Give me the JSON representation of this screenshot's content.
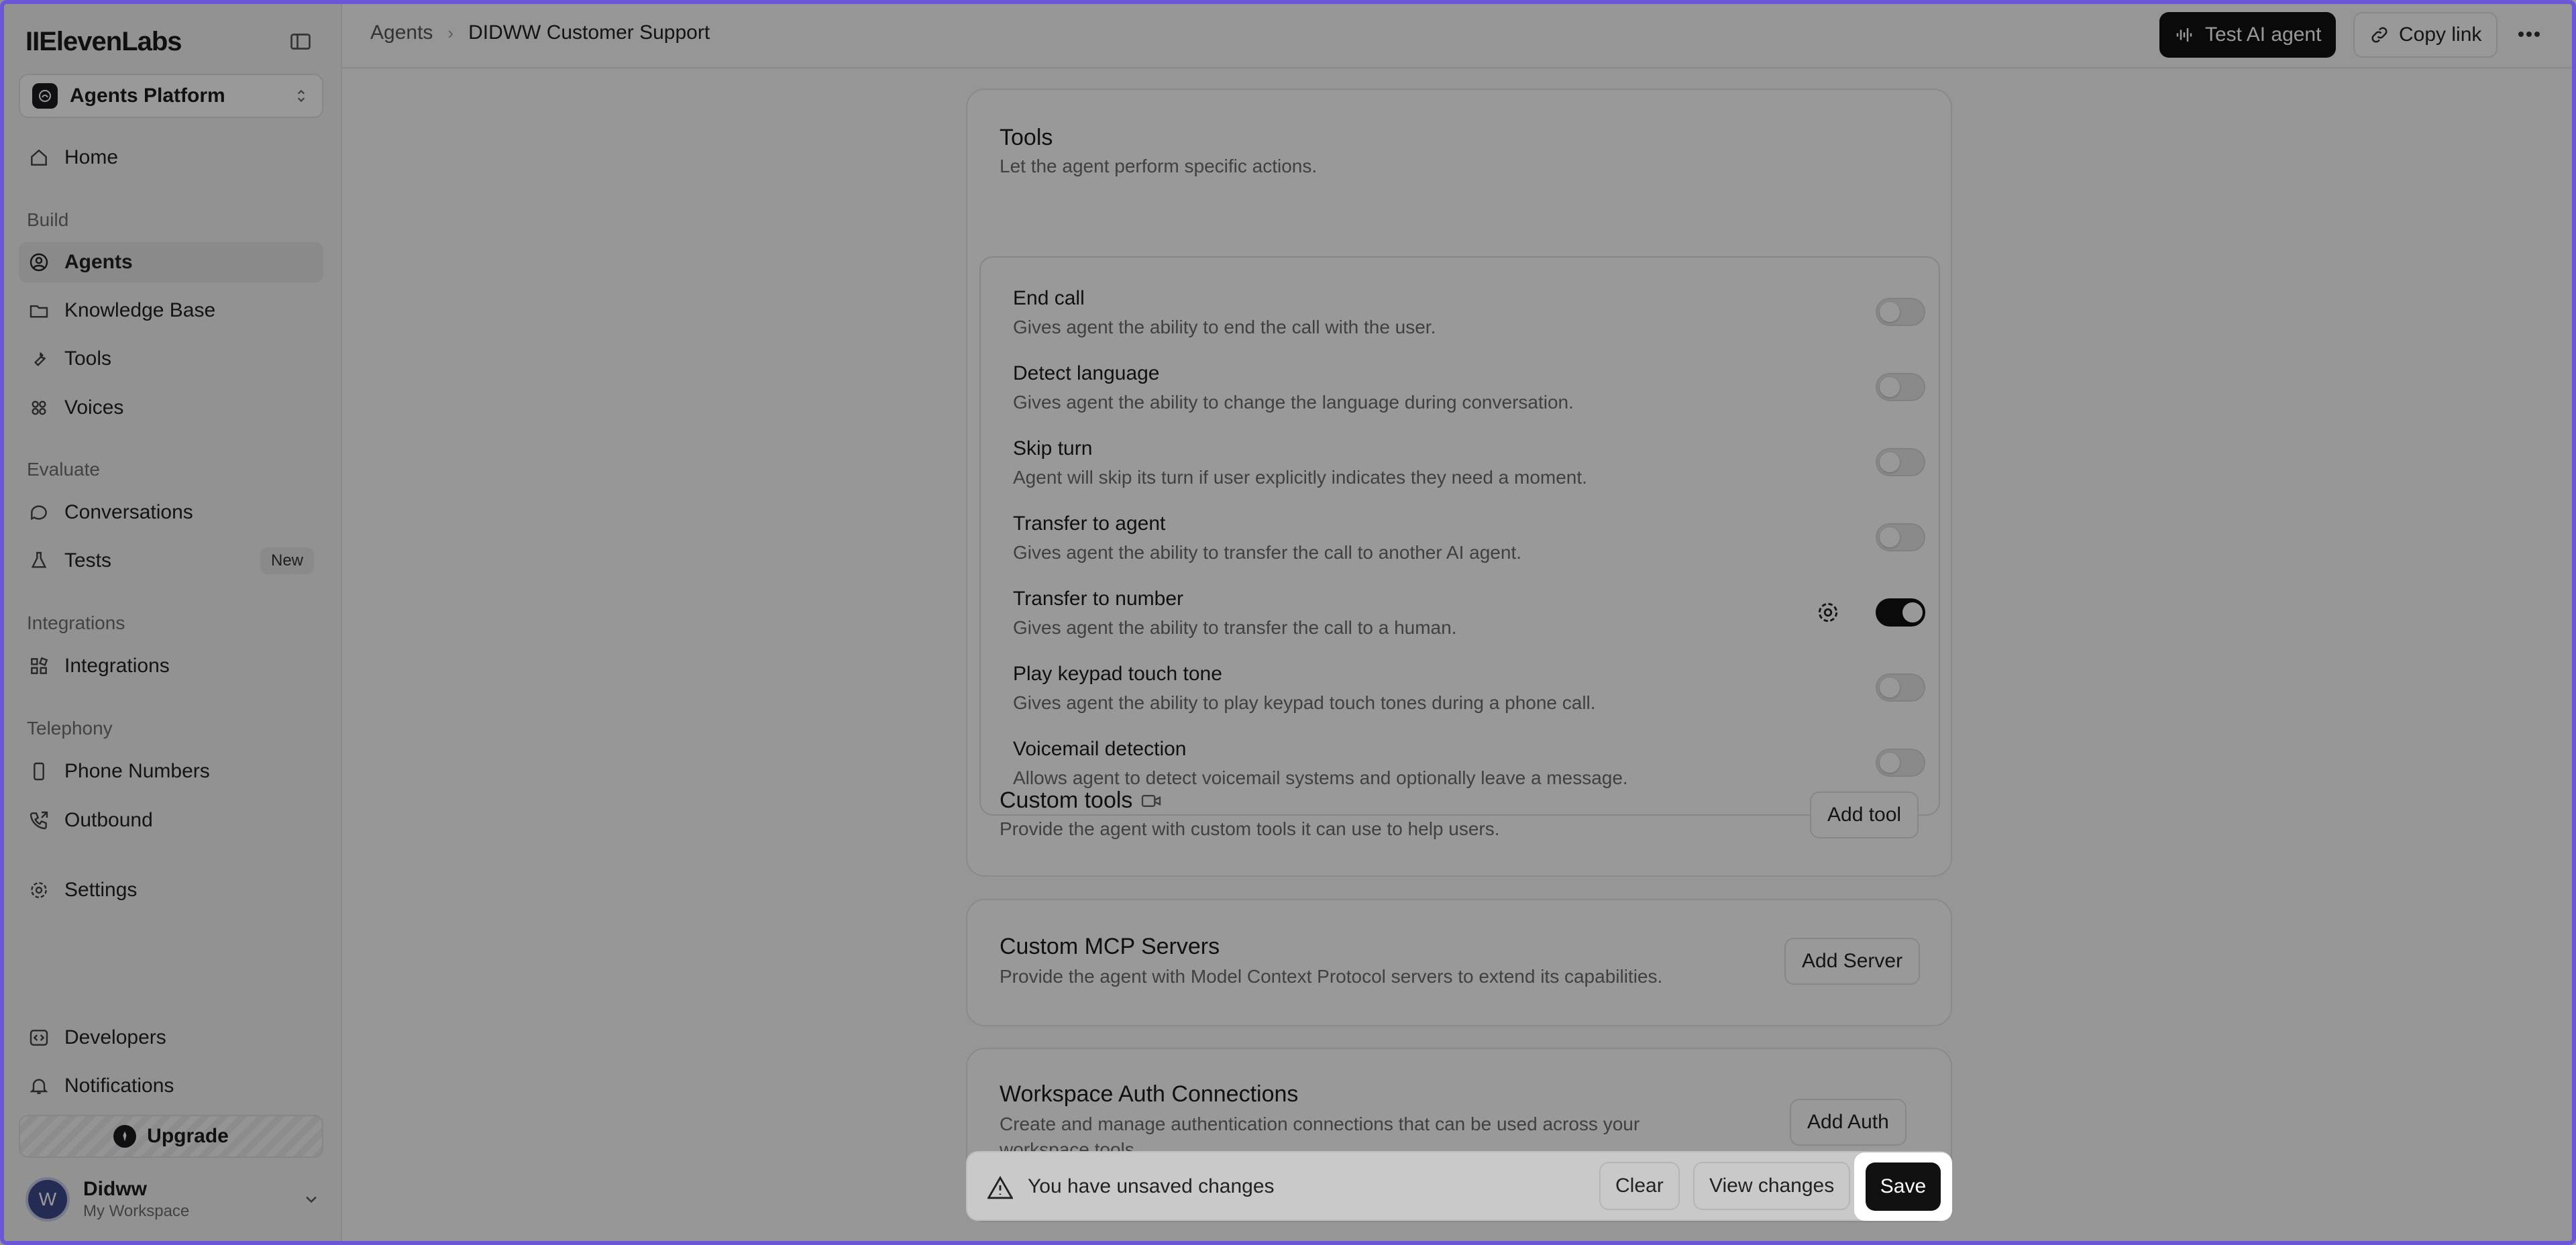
{
  "app": {
    "logo": "IIElevenLabs"
  },
  "sidebar": {
    "platform": "Agents Platform",
    "home": "Home",
    "sections": {
      "build": "Build",
      "evaluate": "Evaluate",
      "integrations": "Integrations",
      "telephony": "Telephony"
    },
    "items": {
      "agents": "Agents",
      "knowledge_base": "Knowledge Base",
      "tools": "Tools",
      "voices": "Voices",
      "conversations": "Conversations",
      "tests": "Tests",
      "tests_badge": "New",
      "integrations": "Integrations",
      "phone_numbers": "Phone Numbers",
      "outbound": "Outbound",
      "settings": "Settings",
      "developers": "Developers",
      "notifications": "Notifications"
    },
    "upgrade": "Upgrade",
    "user": {
      "initial": "W",
      "name": "Didww",
      "workspace": "My Workspace"
    }
  },
  "header": {
    "breadcrumb_parent": "Agents",
    "breadcrumb_separator": "›",
    "breadcrumb_current": "DIDWW Customer Support",
    "test_button": "Test AI agent",
    "copy_button": "Copy link"
  },
  "tools_panel": {
    "title": "Tools",
    "description": "Let the agent perform specific actions.",
    "items": [
      {
        "name": "End call",
        "description": "Gives agent the ability to end the call with the user.",
        "enabled": false
      },
      {
        "name": "Detect language",
        "description": "Gives agent the ability to change the language during conversation.",
        "enabled": false
      },
      {
        "name": "Skip turn",
        "description": "Agent will skip its turn if user explicitly indicates they need a moment.",
        "enabled": false
      },
      {
        "name": "Transfer to agent",
        "description": "Gives agent the ability to transfer the call to another AI agent.",
        "enabled": false
      },
      {
        "name": "Transfer to number",
        "description": "Gives agent the ability to transfer the call to a human.",
        "enabled": true
      },
      {
        "name": "Play keypad touch tone",
        "description": "Gives agent the ability to play keypad touch tones during a phone call.",
        "enabled": false
      },
      {
        "name": "Voicemail detection",
        "description": "Allows agent to detect voicemail systems and optionally leave a message.",
        "enabled": false
      }
    ],
    "custom_tools": {
      "title": "Custom tools",
      "description": "Provide the agent with custom tools it can use to help users.",
      "button": "Add tool"
    }
  },
  "mcp_panel": {
    "title": "Custom MCP Servers",
    "description": "Provide the agent with Model Context Protocol servers to extend its capabilities.",
    "button": "Add Server"
  },
  "auth_panel": {
    "title": "Workspace Auth Connections",
    "description": "Create and manage authentication connections that can be used across your",
    "description_cont": "workspace tools.",
    "button": "Add Auth"
  },
  "unsaved_bar": {
    "message": "You have unsaved changes",
    "clear": "Clear",
    "view_changes": "View changes",
    "save": "Save"
  },
  "colors": {
    "accent": "#111111",
    "frame": "#6c55d9",
    "toggle_off": "#e6e6e6"
  }
}
